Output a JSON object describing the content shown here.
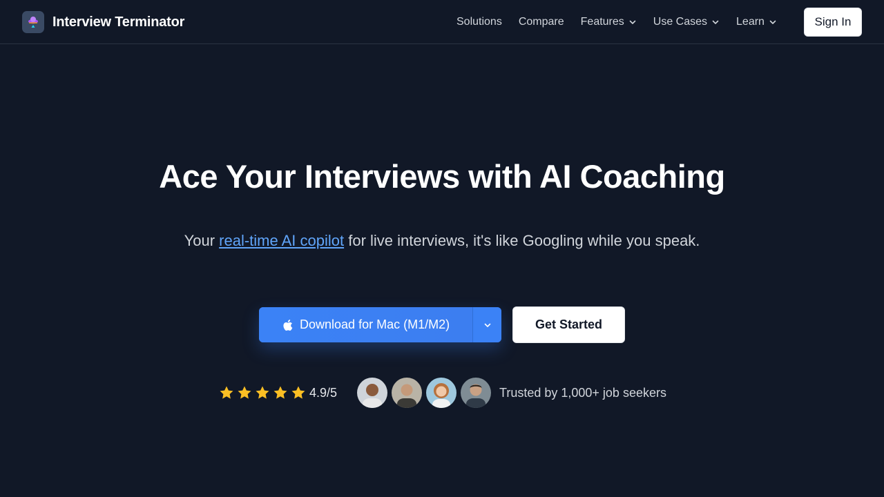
{
  "header": {
    "brand": "Interview Terminator",
    "nav": [
      {
        "label": "Solutions",
        "has_dropdown": false
      },
      {
        "label": "Compare",
        "has_dropdown": false
      },
      {
        "label": "Features",
        "has_dropdown": true
      },
      {
        "label": "Use Cases",
        "has_dropdown": true
      },
      {
        "label": "Learn",
        "has_dropdown": true
      }
    ],
    "signin_label": "Sign In"
  },
  "hero": {
    "title": "Ace Your Interviews with AI Coaching",
    "subtitle_before": "Your ",
    "subtitle_link": "real-time AI copilot",
    "subtitle_after": " for live interviews, it's like Googling while you speak."
  },
  "cta": {
    "download_label": "Download for Mac (M1/M2)",
    "get_started_label": "Get Started"
  },
  "social_proof": {
    "stars": 5,
    "rating": "4.9/5",
    "trusted_text": "Trusted by 1,000+ job seekers"
  },
  "colors": {
    "background": "#111827",
    "accent": "#3b82f6",
    "link": "#60a5fa",
    "star": "#fbbf24"
  },
  "icons": {
    "brand": "logo-icon",
    "apple": "apple-icon",
    "dropdown": "chevron-down-icon",
    "star": "star-icon"
  }
}
